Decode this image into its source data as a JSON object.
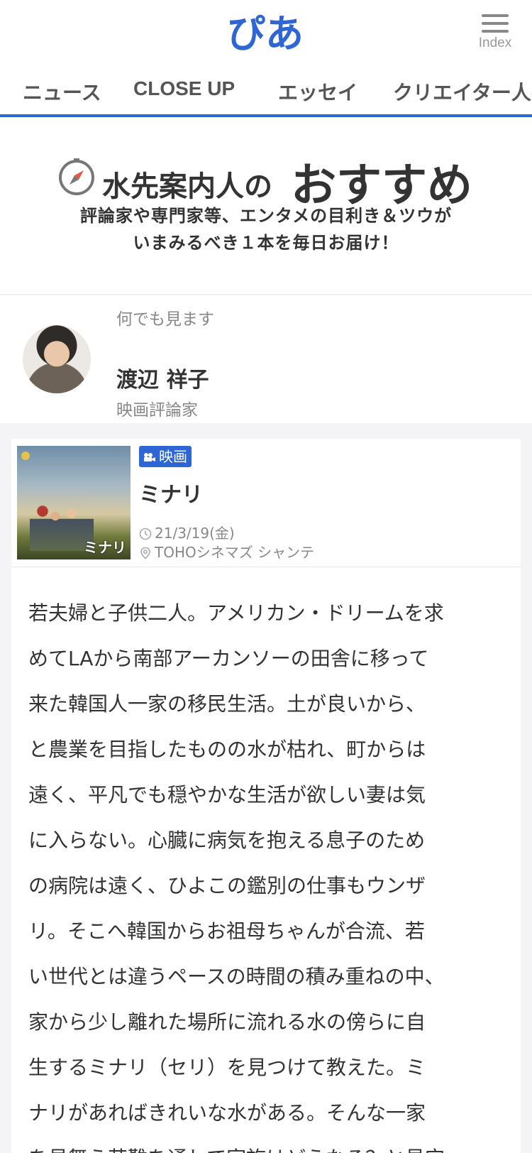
{
  "header": {
    "logo_text": "ぴあ",
    "logo_color": "#2f66d6",
    "menu_label": "Index",
    "menu_icon": "hamburger-menu-icon"
  },
  "nav": {
    "items": [
      "ニュース",
      "CLOSE UP",
      "エッセイ",
      "クリエイター人名"
    ],
    "accent": "#2f66d6"
  },
  "hero": {
    "icon": "compass-icon",
    "title_small": "水先案内人の",
    "title_big": "おすすめ",
    "subtitle_line1": "評論家や専門家等、エンタメの目利き＆ツウが",
    "subtitle_line2": "いまみるべき１本を毎日お届け！"
  },
  "profile": {
    "tagline": "何でも見ます",
    "name": "渡辺 祥子",
    "role": "映画評論家"
  },
  "movie": {
    "genre": "映画",
    "genre_icon": "movie-camera-icon",
    "title": "ミナリ",
    "poster_title": "ミナリ",
    "date": "21/3/19(金)",
    "theater": "TOHOシネマズ シャンテ"
  },
  "review": {
    "lines": [
      "若夫婦と子供二人。アメリカン・ドリームを求",
      "めてLAから南部アーカンソーの田舎に移って",
      "来た韓国人一家の移民生活。土が良いから、",
      "と農業を目指したものの水が枯れ、町からは",
      "遠く、平凡でも穏やかな生活が欲しい妻は気",
      "に入らない。心臓に病気を抱える息子のため",
      "の病院は遠く、ひよこの鑑別の仕事もウンザ",
      "リ。そこへ韓国からお祖母ちゃんが合流、若",
      "い世代とは違うペースの時間の積み重ねの中、",
      "家から少し離れた場所に流れる水の傍らに自",
      "生するミナリ（セリ）を見つけて教えた。ミ",
      "ナリがあればきれいな水がある。そんな一家",
      "を見舞う苦難を通して家族はどうなる？と見守"
    ]
  }
}
